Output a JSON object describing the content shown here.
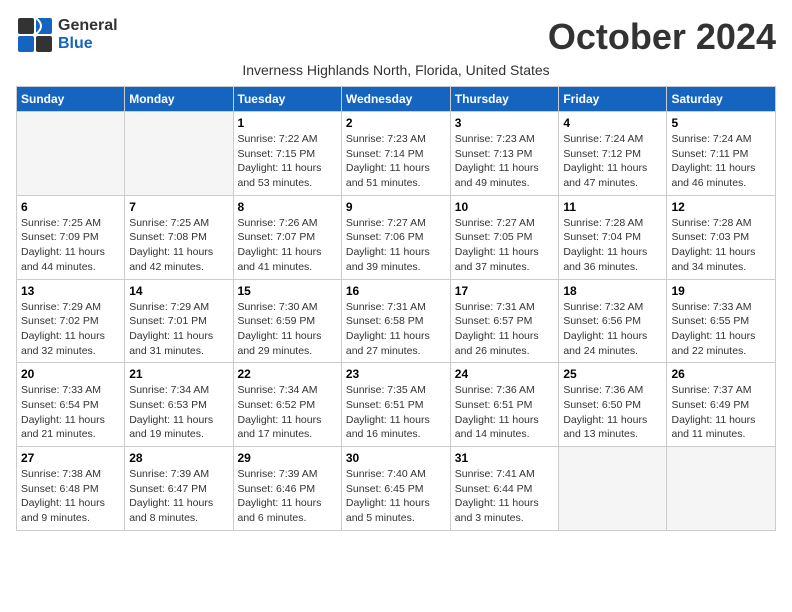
{
  "logo": {
    "general": "General",
    "blue": "Blue"
  },
  "title": "October 2024",
  "subtitle": "Inverness Highlands North, Florida, United States",
  "days_of_week": [
    "Sunday",
    "Monday",
    "Tuesday",
    "Wednesday",
    "Thursday",
    "Friday",
    "Saturday"
  ],
  "weeks": [
    [
      {
        "day": "",
        "info": ""
      },
      {
        "day": "",
        "info": ""
      },
      {
        "day": "1",
        "info": "Sunrise: 7:22 AM\nSunset: 7:15 PM\nDaylight: 11 hours and 53 minutes."
      },
      {
        "day": "2",
        "info": "Sunrise: 7:23 AM\nSunset: 7:14 PM\nDaylight: 11 hours and 51 minutes."
      },
      {
        "day": "3",
        "info": "Sunrise: 7:23 AM\nSunset: 7:13 PM\nDaylight: 11 hours and 49 minutes."
      },
      {
        "day": "4",
        "info": "Sunrise: 7:24 AM\nSunset: 7:12 PM\nDaylight: 11 hours and 47 minutes."
      },
      {
        "day": "5",
        "info": "Sunrise: 7:24 AM\nSunset: 7:11 PM\nDaylight: 11 hours and 46 minutes."
      }
    ],
    [
      {
        "day": "6",
        "info": "Sunrise: 7:25 AM\nSunset: 7:09 PM\nDaylight: 11 hours and 44 minutes."
      },
      {
        "day": "7",
        "info": "Sunrise: 7:25 AM\nSunset: 7:08 PM\nDaylight: 11 hours and 42 minutes."
      },
      {
        "day": "8",
        "info": "Sunrise: 7:26 AM\nSunset: 7:07 PM\nDaylight: 11 hours and 41 minutes."
      },
      {
        "day": "9",
        "info": "Sunrise: 7:27 AM\nSunset: 7:06 PM\nDaylight: 11 hours and 39 minutes."
      },
      {
        "day": "10",
        "info": "Sunrise: 7:27 AM\nSunset: 7:05 PM\nDaylight: 11 hours and 37 minutes."
      },
      {
        "day": "11",
        "info": "Sunrise: 7:28 AM\nSunset: 7:04 PM\nDaylight: 11 hours and 36 minutes."
      },
      {
        "day": "12",
        "info": "Sunrise: 7:28 AM\nSunset: 7:03 PM\nDaylight: 11 hours and 34 minutes."
      }
    ],
    [
      {
        "day": "13",
        "info": "Sunrise: 7:29 AM\nSunset: 7:02 PM\nDaylight: 11 hours and 32 minutes."
      },
      {
        "day": "14",
        "info": "Sunrise: 7:29 AM\nSunset: 7:01 PM\nDaylight: 11 hours and 31 minutes."
      },
      {
        "day": "15",
        "info": "Sunrise: 7:30 AM\nSunset: 6:59 PM\nDaylight: 11 hours and 29 minutes."
      },
      {
        "day": "16",
        "info": "Sunrise: 7:31 AM\nSunset: 6:58 PM\nDaylight: 11 hours and 27 minutes."
      },
      {
        "day": "17",
        "info": "Sunrise: 7:31 AM\nSunset: 6:57 PM\nDaylight: 11 hours and 26 minutes."
      },
      {
        "day": "18",
        "info": "Sunrise: 7:32 AM\nSunset: 6:56 PM\nDaylight: 11 hours and 24 minutes."
      },
      {
        "day": "19",
        "info": "Sunrise: 7:33 AM\nSunset: 6:55 PM\nDaylight: 11 hours and 22 minutes."
      }
    ],
    [
      {
        "day": "20",
        "info": "Sunrise: 7:33 AM\nSunset: 6:54 PM\nDaylight: 11 hours and 21 minutes."
      },
      {
        "day": "21",
        "info": "Sunrise: 7:34 AM\nSunset: 6:53 PM\nDaylight: 11 hours and 19 minutes."
      },
      {
        "day": "22",
        "info": "Sunrise: 7:34 AM\nSunset: 6:52 PM\nDaylight: 11 hours and 17 minutes."
      },
      {
        "day": "23",
        "info": "Sunrise: 7:35 AM\nSunset: 6:51 PM\nDaylight: 11 hours and 16 minutes."
      },
      {
        "day": "24",
        "info": "Sunrise: 7:36 AM\nSunset: 6:51 PM\nDaylight: 11 hours and 14 minutes."
      },
      {
        "day": "25",
        "info": "Sunrise: 7:36 AM\nSunset: 6:50 PM\nDaylight: 11 hours and 13 minutes."
      },
      {
        "day": "26",
        "info": "Sunrise: 7:37 AM\nSunset: 6:49 PM\nDaylight: 11 hours and 11 minutes."
      }
    ],
    [
      {
        "day": "27",
        "info": "Sunrise: 7:38 AM\nSunset: 6:48 PM\nDaylight: 11 hours and 9 minutes."
      },
      {
        "day": "28",
        "info": "Sunrise: 7:39 AM\nSunset: 6:47 PM\nDaylight: 11 hours and 8 minutes."
      },
      {
        "day": "29",
        "info": "Sunrise: 7:39 AM\nSunset: 6:46 PM\nDaylight: 11 hours and 6 minutes."
      },
      {
        "day": "30",
        "info": "Sunrise: 7:40 AM\nSunset: 6:45 PM\nDaylight: 11 hours and 5 minutes."
      },
      {
        "day": "31",
        "info": "Sunrise: 7:41 AM\nSunset: 6:44 PM\nDaylight: 11 hours and 3 minutes."
      },
      {
        "day": "",
        "info": ""
      },
      {
        "day": "",
        "info": ""
      }
    ]
  ]
}
